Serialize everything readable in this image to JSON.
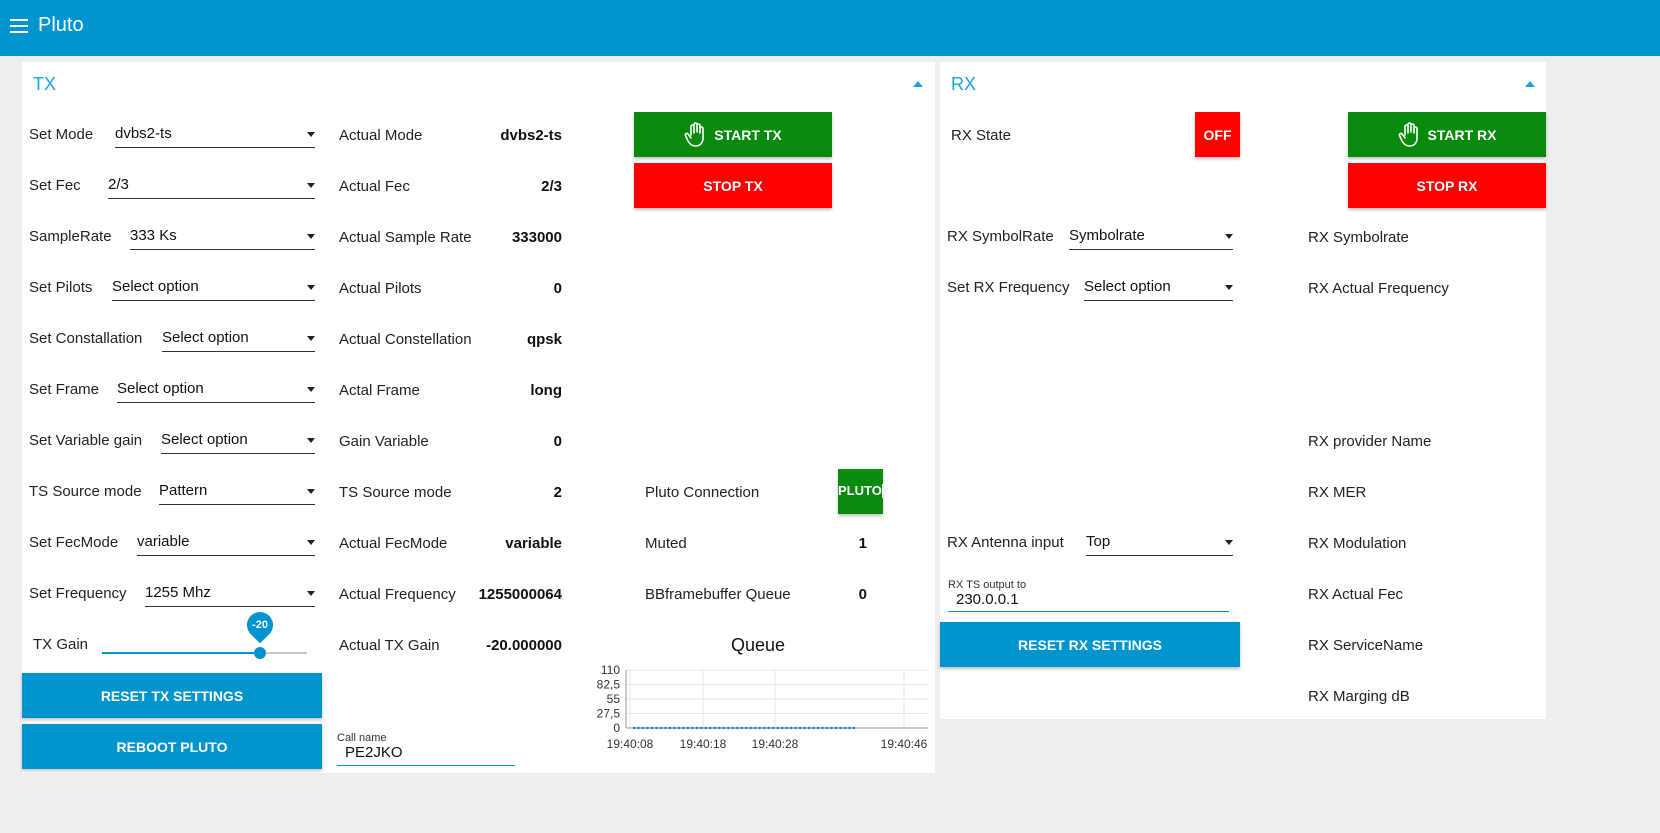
{
  "app": {
    "title": "Pluto",
    "menu_icon": "hamburger-menu-icon"
  },
  "tx": {
    "title": "TX",
    "controls": [
      {
        "label": "Set Mode",
        "value": "dvbs2-ts"
      },
      {
        "label": "Set Fec",
        "value": "2/3"
      },
      {
        "label": "SampleRate",
        "value": "333 Ks"
      },
      {
        "label": "Set Pilots",
        "value": "Select option"
      },
      {
        "label": "Set Constallation",
        "value": "Select option"
      },
      {
        "label": "Set Frame",
        "value": "Select option"
      },
      {
        "label": "Set Variable gain",
        "value": "Select option"
      },
      {
        "label": "TS Source mode",
        "value": "Pattern"
      },
      {
        "label": "Set FecMode",
        "value": "variable"
      },
      {
        "label": "Set Frequency",
        "value": "1255 Mhz"
      }
    ],
    "gain": {
      "label": "TX Gain",
      "value": "-20",
      "level_percent": 77
    },
    "actuals": [
      {
        "label": "Actual Mode",
        "value": "dvbs2-ts"
      },
      {
        "label": "Actual Fec",
        "value": "2/3"
      },
      {
        "label": "Actual Sample Rate",
        "value": "333000"
      },
      {
        "label": "Actual Pilots",
        "value": "0"
      },
      {
        "label": "Actual Constellation",
        "value": "qpsk"
      },
      {
        "label": "Actal Frame",
        "value": "long"
      },
      {
        "label": "Gain Variable",
        "value": "0"
      },
      {
        "label": "TS Source mode",
        "value": "2"
      },
      {
        "label": "Actual FecMode",
        "value": "variable"
      },
      {
        "label": "Actual Frequency",
        "value": "1255000064"
      },
      {
        "label": "Actual TX Gain",
        "value": "-20.000000"
      }
    ],
    "start_label": "START TX",
    "stop_label": "STOP TX",
    "reset_label": "RESET TX SETTINGS",
    "reboot_label": "REBOOT PLUTO",
    "callname": {
      "label": "Call name",
      "value": "PE2JKO"
    },
    "status": [
      {
        "label": "Pluto Connection",
        "value": "PLUTO"
      },
      {
        "label": "Muted",
        "value": "1"
      },
      {
        "label": "BBframebuffer Queue",
        "value": "0"
      }
    ]
  },
  "chart_data": {
    "type": "line",
    "title": "Queue",
    "x_ticks": [
      "19:40:08",
      "19:40:18",
      "19:40:28",
      "19:40:46"
    ],
    "y_ticks": [
      "110",
      "82,5",
      "55",
      "27,5",
      "0"
    ],
    "ylim": [
      0,
      110
    ],
    "series": [
      {
        "values": [
          0,
          0,
          0,
          0,
          0,
          0,
          0,
          0,
          0,
          0,
          0,
          0,
          0,
          0,
          0,
          0,
          0,
          0,
          0,
          0,
          0,
          0,
          0,
          0,
          0,
          0,
          0,
          0,
          0,
          0,
          0,
          0,
          0,
          0,
          0,
          0,
          0,
          0,
          0,
          0,
          0,
          0,
          0,
          0,
          0,
          0,
          0,
          0,
          0,
          0
        ]
      }
    ],
    "color": "#1f77d0",
    "grid": true
  },
  "rx": {
    "title": "RX",
    "state": {
      "label": "RX State",
      "value": "OFF"
    },
    "start_label": "START RX",
    "stop_label": "STOP RX",
    "controls": [
      {
        "label": "RX SymbolRate",
        "value": "Symbolrate"
      },
      {
        "label": "Set RX Frequency",
        "value": "Select option"
      },
      {
        "label": "RX Antenna input",
        "value": "Top"
      }
    ],
    "ts_output": {
      "label": "RX TS output to",
      "value": "230.0.0.1"
    },
    "reset_label": "RESET RX SETTINGS",
    "info": [
      "RX Symbolrate",
      "RX Actual Frequency",
      "RX provider Name",
      "RX MER",
      "RX Modulation",
      "RX Actual Fec",
      "RX ServiceName",
      "RX Marging dB"
    ]
  },
  "colors": {
    "accent": "#0094ce",
    "start": "#088a0c",
    "stop": "#ff0000",
    "title": "#1aa3e0"
  }
}
